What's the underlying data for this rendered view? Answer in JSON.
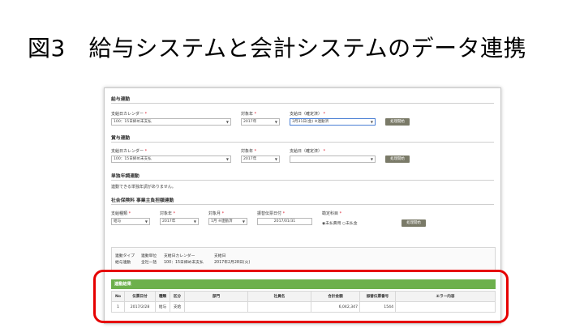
{
  "slide": {
    "title": "図3　給与システムと会計システムのデータ連携"
  },
  "salary_link": {
    "title": "給与連動",
    "calendar_label": "支給日カレンダー",
    "calendar_value": "100：15日締め末支払",
    "year_label": "対象年",
    "year_value": "2017年",
    "payday_label": "支給日（確定済）",
    "payday_value": "3月31日(金) ※連動済",
    "button": "処理開始"
  },
  "bonus_link": {
    "title": "賞与連動",
    "calendar_label": "支給日カレンダー",
    "calendar_value": "100：15日締め末支払",
    "year_label": "対象年",
    "year_value": "2017年",
    "payday_label": "支給日（確定済）",
    "payday_value": "",
    "button": "処理開始"
  },
  "year_end": {
    "title": "単独年調連動",
    "message": "連動できる単独年調がありません。"
  },
  "insurance": {
    "title": "社会保険料 事業主負担額連動",
    "type_label": "支給種類",
    "type_value": "給与",
    "year_label": "対象年",
    "year_value": "2017年",
    "month_label": "対象月",
    "month_value": "1月 ※連動済",
    "date_label": "振替伝票日付",
    "date_value": "2017/01/31",
    "account_label": "勘定科目",
    "option1": "未払費用",
    "option2": "未払金",
    "button": "処理開始"
  },
  "link_info": {
    "headers": [
      "連動タイプ",
      "連動単位",
      "支給日カレンダー",
      "支給日"
    ],
    "values": [
      "給与連動",
      "全社一括",
      "100：15日締め末支払",
      "2017年2月28日(火)"
    ]
  },
  "result": {
    "title": "連動結果",
    "columns": [
      "No",
      "伝票日付",
      "種類",
      "区分",
      "部門",
      "社員名",
      "合計金額",
      "振替伝票番号",
      "エラー内容"
    ],
    "rows": [
      [
        "1",
        "2017/2/28",
        "給与",
        "支給",
        "",
        "",
        "6,042,347",
        "1544",
        ""
      ]
    ]
  },
  "colors": {
    "accent_green": "#6db04c",
    "highlight_red": "#e60000",
    "button_gray": "#7a7a68",
    "required_red": "#dd2233"
  }
}
